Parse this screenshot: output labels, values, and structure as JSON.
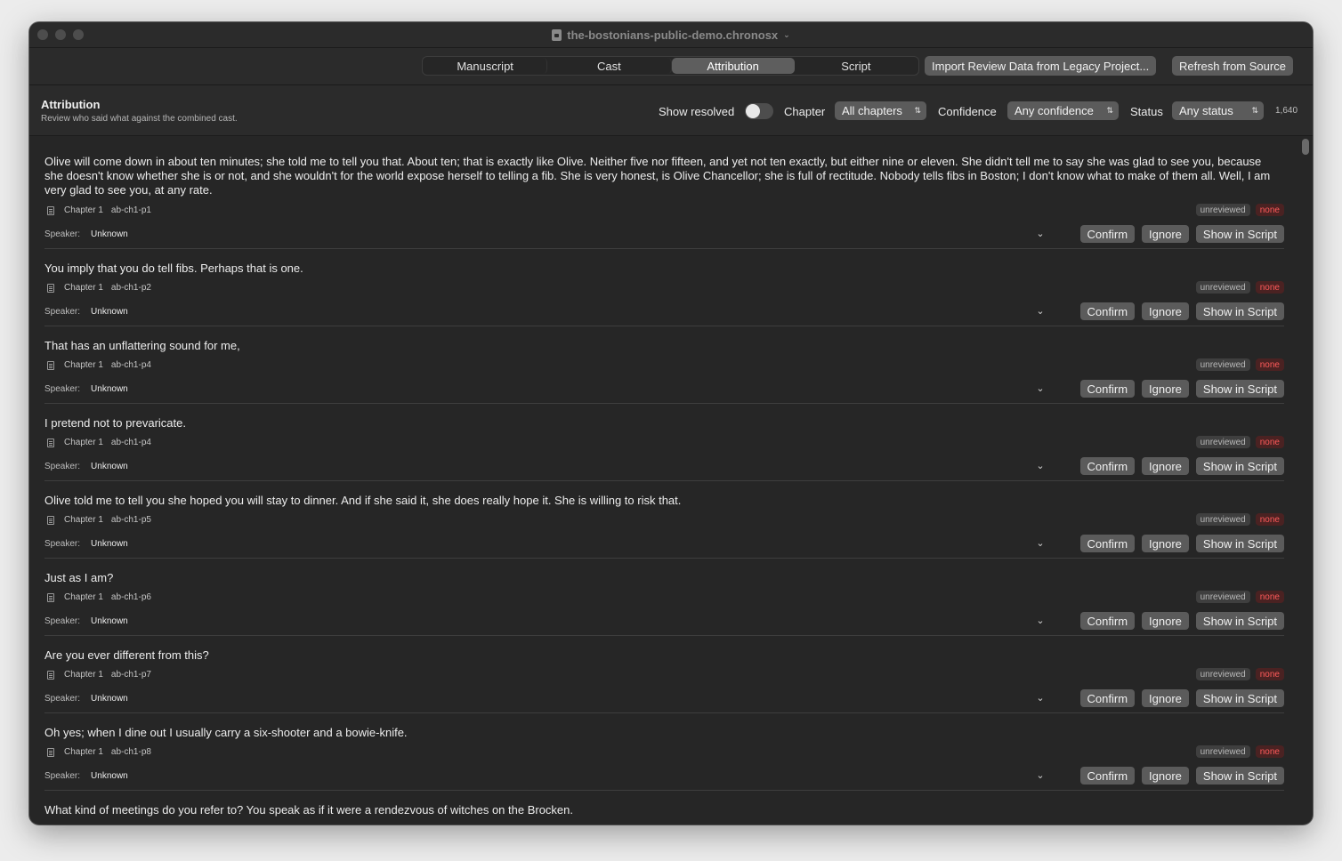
{
  "window": {
    "title": "the-bostonians-public-demo.chronosx"
  },
  "toolbar": {
    "tabs": [
      {
        "label": "Manuscript"
      },
      {
        "label": "Cast"
      },
      {
        "label": "Attribution"
      },
      {
        "label": "Script"
      }
    ],
    "active_tab": "Attribution",
    "import_label": "Import Review Data from Legacy Project...",
    "refresh_label": "Refresh from Source"
  },
  "header": {
    "title": "Attribution",
    "subtitle": "Review who said what against the combined cast.",
    "show_resolved_label": "Show resolved",
    "show_resolved": false,
    "chapter_label": "Chapter",
    "chapter_value": "All chapters",
    "confidence_label": "Confidence",
    "confidence_value": "Any confidence",
    "status_label": "Status",
    "status_value": "Any status",
    "count": "1,640"
  },
  "labels": {
    "speaker": "Speaker:",
    "confirm": "Confirm",
    "ignore": "Ignore",
    "show_in_script": "Show in Script"
  },
  "colors": {
    "confidence_none": "#ff5a5a",
    "active_tab": "#5e5e5e"
  },
  "items": [
    {
      "text": "Olive will come down in about ten minutes; she told me to tell you that. About ten; that is exactly like Olive. Neither five nor fifteen, and yet not ten exactly, but either nine or eleven. She didn't tell me to say she was glad to see you, because she doesn't know whether she is or not, and she wouldn't for the world expose herself to telling a fib. She is very honest, is Olive Chancellor; she is full of rectitude. Nobody tells fibs in Boston; I don't know what to make of them all. Well, I am very glad to see you, at any rate.",
      "chapter": "Chapter 1",
      "id": "ab-ch1-p1",
      "status": "unreviewed",
      "confidence": "none",
      "speaker": "Unknown"
    },
    {
      "text": "You imply that you do tell fibs. Perhaps that is one.",
      "chapter": "Chapter 1",
      "id": "ab-ch1-p2",
      "status": "unreviewed",
      "confidence": "none",
      "speaker": "Unknown"
    },
    {
      "text": "That has an unflattering sound for me,",
      "chapter": "Chapter 1",
      "id": "ab-ch1-p4",
      "status": "unreviewed",
      "confidence": "none",
      "speaker": "Unknown"
    },
    {
      "text": "I pretend not to prevaricate.",
      "chapter": "Chapter 1",
      "id": "ab-ch1-p4",
      "status": "unreviewed",
      "confidence": "none",
      "speaker": "Unknown"
    },
    {
      "text": "Olive told me to tell you she hoped you will stay to dinner. And if she said it, she does really hope it. She is willing to risk that.",
      "chapter": "Chapter 1",
      "id": "ab-ch1-p5",
      "status": "unreviewed",
      "confidence": "none",
      "speaker": "Unknown"
    },
    {
      "text": "Just as I am?",
      "chapter": "Chapter 1",
      "id": "ab-ch1-p6",
      "status": "unreviewed",
      "confidence": "none",
      "speaker": "Unknown"
    },
    {
      "text": "Are you ever different from this?",
      "chapter": "Chapter 1",
      "id": "ab-ch1-p7",
      "status": "unreviewed",
      "confidence": "none",
      "speaker": "Unknown"
    },
    {
      "text": "Oh yes; when I dine out I usually carry a six-shooter and a bowie-knife.",
      "chapter": "Chapter 1",
      "id": "ab-ch1-p8",
      "status": "unreviewed",
      "confidence": "none",
      "speaker": "Unknown"
    },
    {
      "text": "What kind of meetings do you refer to? You speak as if it were a rendezvous of witches on the Brocken."
    }
  ]
}
